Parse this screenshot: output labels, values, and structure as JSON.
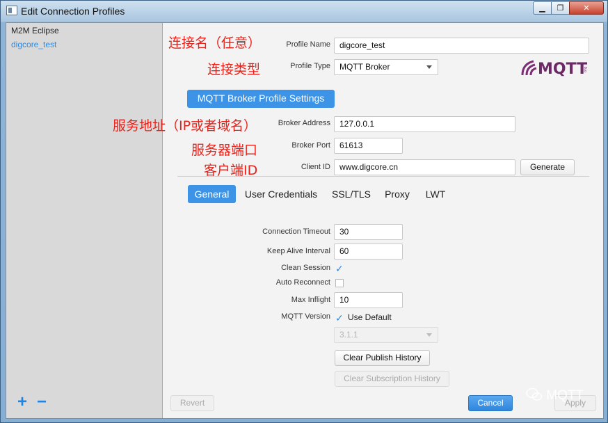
{
  "window": {
    "title": "Edit Connection Profiles",
    "min_label": "▁",
    "max_label": "❐",
    "close_label": "✕"
  },
  "sidebar": {
    "items": [
      {
        "label": "M2M Eclipse"
      },
      {
        "label": "digcore_test"
      }
    ],
    "add_label": "+",
    "remove_label": "−"
  },
  "annotations": {
    "profile_name": "连接名（任意）",
    "profile_type": "连接类型",
    "broker_address": "服务地址（IP或者域名）",
    "broker_port": "服务器端口",
    "client_id": "客户端ID"
  },
  "profile": {
    "name_label": "Profile Name",
    "name_value": "digcore_test",
    "type_label": "Profile Type",
    "type_value": "MQTT Broker",
    "logo_text": "MQTT",
    "logo_tiny": "org"
  },
  "broker": {
    "section_label": "MQTT Broker Profile Settings",
    "address_label": "Broker Address",
    "address_value": "127.0.0.1",
    "port_label": "Broker Port",
    "port_value": "61613",
    "client_id_label": "Client ID",
    "client_id_value": "www.digcore.cn",
    "generate_label": "Generate"
  },
  "tabs": [
    {
      "label": "General",
      "active": true
    },
    {
      "label": "User Credentials"
    },
    {
      "label": "SSL/TLS"
    },
    {
      "label": "Proxy"
    },
    {
      "label": "LWT"
    }
  ],
  "general": {
    "connection_timeout_label": "Connection Timeout",
    "connection_timeout_value": "30",
    "keep_alive_label": "Keep Alive Interval",
    "keep_alive_value": "60",
    "clean_session_label": "Clean Session",
    "clean_session_checked": true,
    "auto_reconnect_label": "Auto Reconnect",
    "auto_reconnect_checked": false,
    "max_inflight_label": "Max Inflight",
    "max_inflight_value": "10",
    "mqtt_version_label": "MQTT Version",
    "use_default_label": "Use Default",
    "use_default_checked": true,
    "version_value": "3.1.1",
    "clear_publish_label": "Clear Publish History",
    "clear_subscription_label": "Clear Subscription History"
  },
  "footer": {
    "revert_label": "Revert",
    "cancel_label": "Cancel",
    "apply_label": "Apply"
  },
  "watermark": {
    "text": "MQTT"
  },
  "colors": {
    "accent": "#3d93e6",
    "annotation": "#e8221a",
    "selected_text": "#2b8be8"
  }
}
